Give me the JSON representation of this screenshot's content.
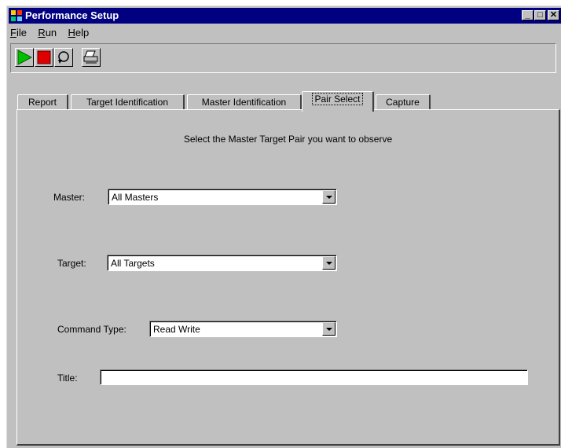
{
  "window": {
    "title": "Performance Setup",
    "controls": {
      "minimize": "_",
      "maximize": "□",
      "close": "✕"
    }
  },
  "menu": [
    "File",
    "Run",
    "Help"
  ],
  "toolbar": [
    "play-icon",
    "stop-icon",
    "loop-icon",
    "print-icon"
  ],
  "tabs": [
    "Report",
    "Target Identification",
    "Master Identification",
    "Pair Select",
    "Capture"
  ],
  "active_tab": "Pair Select",
  "panel": {
    "instruction": "Select the Master Target Pair you want to observe",
    "master": {
      "label": "Master:",
      "value": "All Masters"
    },
    "target": {
      "label": "Target:",
      "value": "All Targets"
    },
    "command_type": {
      "label": "Command Type:",
      "value": "Read Write"
    },
    "title": {
      "label": "Title:",
      "value": ""
    }
  },
  "colors": {
    "titlebar": "#000080",
    "face": "#c0c0c0",
    "play": "#00c000",
    "stop": "#e00000"
  }
}
